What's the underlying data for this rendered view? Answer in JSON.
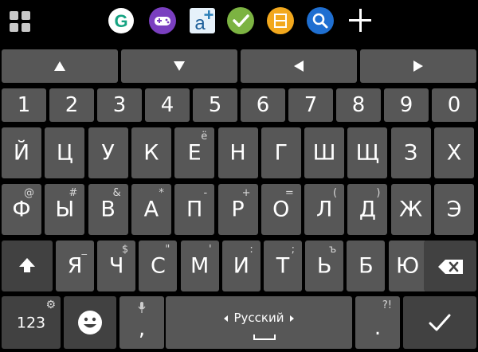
{
  "toolbar": {
    "apps": [
      {
        "name": "grammarly-icon",
        "letter": "G",
        "color": "#16a382"
      },
      {
        "name": "game-controller-icon",
        "color": "#7a3fc0"
      },
      {
        "name": "dictionary-icon",
        "letter": "a",
        "color": "#2c7fb8"
      },
      {
        "name": "check-icon",
        "color": "#7cb342"
      },
      {
        "name": "notes-icon",
        "color": "#f2a81d"
      },
      {
        "name": "search-icon",
        "color": "#1f6fd1"
      }
    ]
  },
  "arrows": [
    "up",
    "down",
    "left",
    "right"
  ],
  "numbers": [
    "1",
    "2",
    "3",
    "4",
    "5",
    "6",
    "7",
    "8",
    "9",
    "0"
  ],
  "row1": [
    {
      "label": "Й"
    },
    {
      "label": "Ц"
    },
    {
      "label": "У"
    },
    {
      "label": "К"
    },
    {
      "label": "Е",
      "hint": "ё"
    },
    {
      "label": "Н"
    },
    {
      "label": "Г"
    },
    {
      "label": "Ш"
    },
    {
      "label": "Щ"
    },
    {
      "label": "З"
    },
    {
      "label": "Х"
    }
  ],
  "row2": [
    {
      "label": "Ф",
      "hint": "@"
    },
    {
      "label": "Ы",
      "hint": "#"
    },
    {
      "label": "В",
      "hint": "&"
    },
    {
      "label": "А",
      "hint": "*"
    },
    {
      "label": "П",
      "hint": "-"
    },
    {
      "label": "Р",
      "hint": "+"
    },
    {
      "label": "О",
      "hint": "="
    },
    {
      "label": "Л",
      "hint": "("
    },
    {
      "label": "Д",
      "hint": ")"
    },
    {
      "label": "Ж"
    },
    {
      "label": "Э"
    }
  ],
  "row3": [
    {
      "label": "Я",
      "hint": "_"
    },
    {
      "label": "Ч",
      "hint": "$"
    },
    {
      "label": "С",
      "hint": "\""
    },
    {
      "label": "М",
      "hint": "'"
    },
    {
      "label": "И",
      "hint": ":"
    },
    {
      "label": "Т",
      "hint": ";"
    },
    {
      "label": "Ь",
      "hint": "ъ"
    },
    {
      "label": "Б"
    },
    {
      "label": "Ю"
    }
  ],
  "bottom": {
    "symbols_label": "123",
    "comma": ",",
    "language": "Русский",
    "period": ".",
    "period_hint": "?!"
  },
  "colors": {
    "key": "#575757",
    "key_dark": "#414141",
    "background": "#000000"
  }
}
